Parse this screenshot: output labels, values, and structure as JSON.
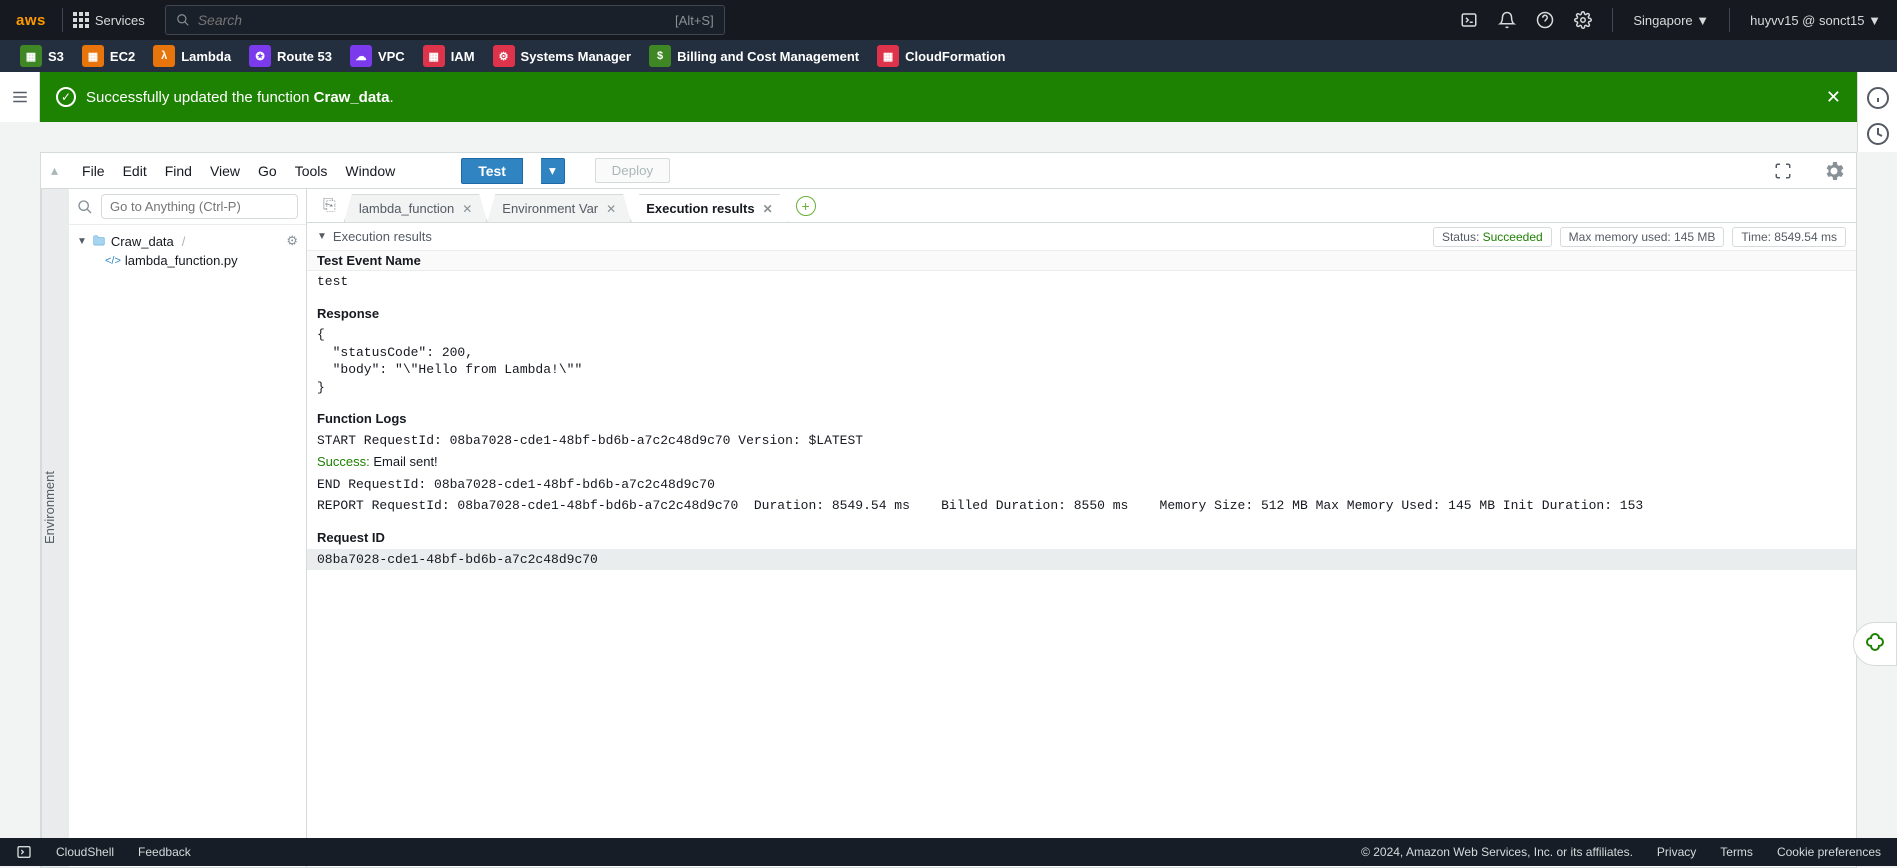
{
  "topnav": {
    "logo": "aws",
    "services": "Services",
    "search_placeholder": "Search",
    "search_hint": "[Alt+S]",
    "region": "Singapore",
    "user": "huyvv15 @ sonct15"
  },
  "servicebar": {
    "items": [
      {
        "name": "S3",
        "color": "#3f8624"
      },
      {
        "name": "EC2",
        "color": "#e8740c"
      },
      {
        "name": "Lambda",
        "color": "#e8740c"
      },
      {
        "name": "Route 53",
        "color": "#7c3aed"
      },
      {
        "name": "VPC",
        "color": "#7c3aed"
      },
      {
        "name": "IAM",
        "color": "#dd344c"
      },
      {
        "name": "Systems Manager",
        "color": "#dd344c"
      },
      {
        "name": "Billing and Cost Management",
        "color": "#3f8624"
      },
      {
        "name": "CloudFormation",
        "color": "#dd344c"
      }
    ]
  },
  "alert": {
    "prefix": "Successfully updated the function ",
    "fn": "Craw_data",
    "suffix": "."
  },
  "menubar": {
    "items": [
      "File",
      "Edit",
      "Find",
      "View",
      "Go",
      "Tools",
      "Window"
    ],
    "test": "Test",
    "deploy": "Deploy"
  },
  "sidebar": {
    "goto_placeholder": "Go to Anything (Ctrl-P)",
    "env_label": "Environment",
    "root": "Craw_data",
    "file": "lambda_function.py"
  },
  "tabs": {
    "t1": "lambda_function",
    "t2": "Environment Var",
    "t3": "Execution results"
  },
  "exec": {
    "header": "Execution results",
    "status_label": "Status: ",
    "status_value": "Succeeded",
    "mem_label": "Max memory used: 145 MB",
    "time_label": "Time: 8549.54 ms",
    "test_event_h": "Test Event Name",
    "test_event_v": "test",
    "response_h": "Response",
    "response_body": "{\n  \"statusCode\": 200,\n  \"body\": \"\\\"Hello from Lambda!\\\"\"\n}",
    "logs_h": "Function Logs",
    "log_start": "START RequestId: 08ba7028-cde1-48bf-bd6b-a7c2c48d9c70 Version: $LATEST",
    "log_success_pre": "Success:",
    "log_success_post": " Email sent!",
    "log_end": "END RequestId: 08ba7028-cde1-48bf-bd6b-a7c2c48d9c70",
    "log_report": "REPORT RequestId: 08ba7028-cde1-48bf-bd6b-a7c2c48d9c70  Duration: 8549.54 ms    Billed Duration: 8550 ms    Memory Size: 512 MB Max Memory Used: 145 MB Init Duration: 153",
    "reqid_h": "Request ID",
    "reqid_v": "08ba7028-cde1-48bf-bd6b-a7c2c48d9c70"
  },
  "footer": {
    "cloudshell": "CloudShell",
    "feedback": "Feedback",
    "copyright": "© 2024, Amazon Web Services, Inc. or its affiliates.",
    "privacy": "Privacy",
    "terms": "Terms",
    "cookie": "Cookie preferences"
  }
}
